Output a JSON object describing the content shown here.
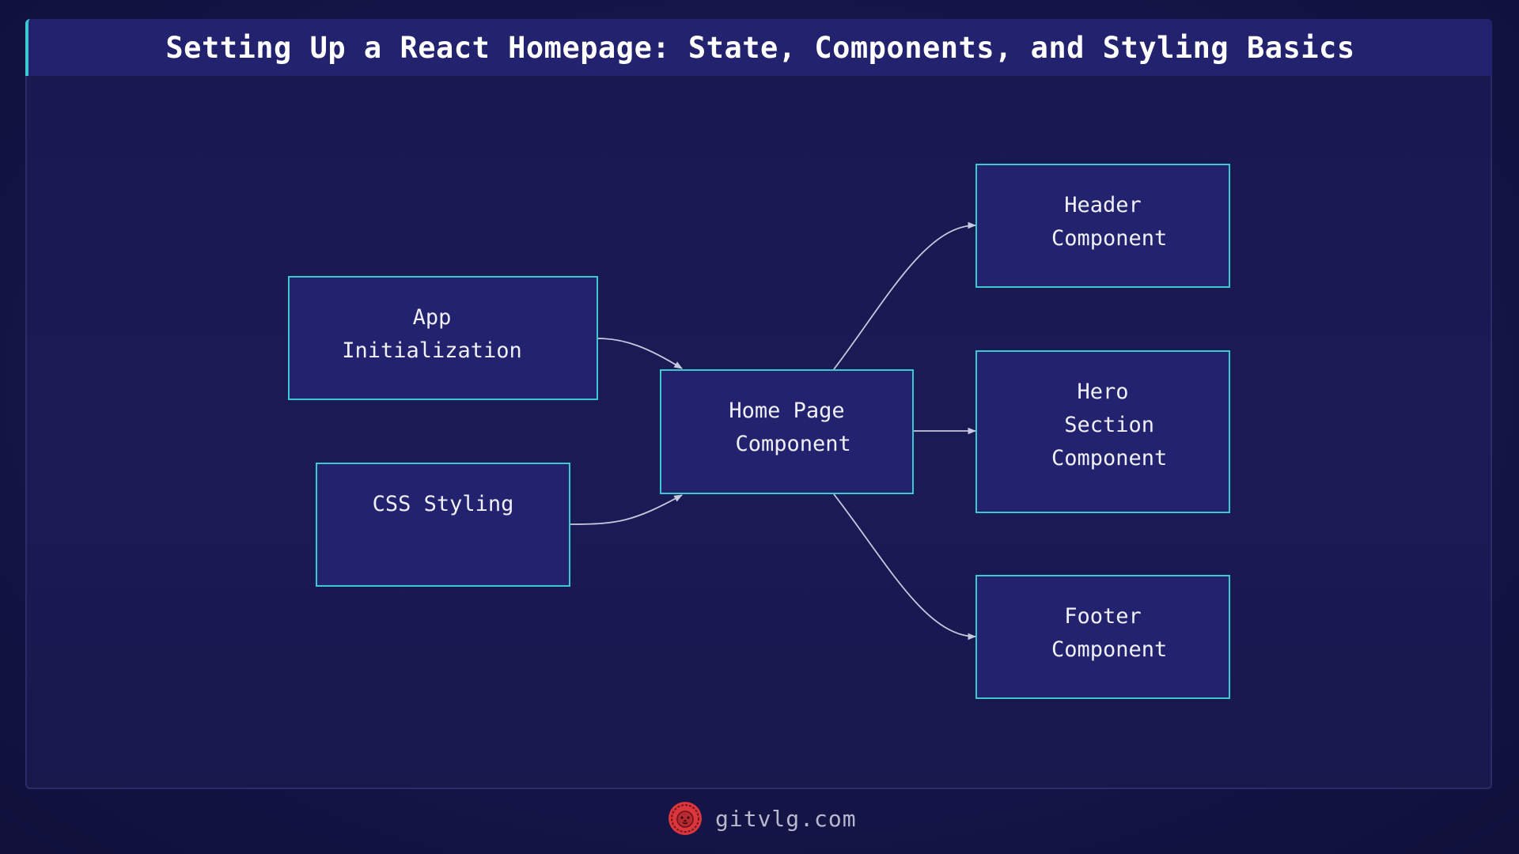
{
  "title": "Setting Up a React Homepage: State, Components, and Styling Basics",
  "colors": {
    "background": "#15154a",
    "node_fill": "#22226e",
    "node_border": "#3cc8d0",
    "edge": "#c8c8e0",
    "title_bar": "#22226e",
    "title_accent": "#3cc8d0",
    "logo": "#d9363e"
  },
  "nodes": [
    {
      "id": "app-init",
      "lines": [
        "App",
        "Initialization"
      ]
    },
    {
      "id": "css-styling",
      "lines": [
        "CSS Styling"
      ]
    },
    {
      "id": "home-page",
      "lines": [
        "Home Page",
        " Component"
      ]
    },
    {
      "id": "header",
      "lines": [
        "Header",
        " Component"
      ]
    },
    {
      "id": "hero",
      "lines": [
        "Hero",
        " Section",
        " Component"
      ]
    },
    {
      "id": "footer",
      "lines": [
        "Footer",
        " Component"
      ]
    }
  ],
  "edges": [
    {
      "from": "app-init",
      "to": "home-page"
    },
    {
      "from": "css-styling",
      "to": "home-page"
    },
    {
      "from": "home-page",
      "to": "header"
    },
    {
      "from": "home-page",
      "to": "hero"
    },
    {
      "from": "home-page",
      "to": "footer"
    }
  ],
  "footer": {
    "logo_icon": "lion-head-icon",
    "text": "gitvlg.com"
  }
}
